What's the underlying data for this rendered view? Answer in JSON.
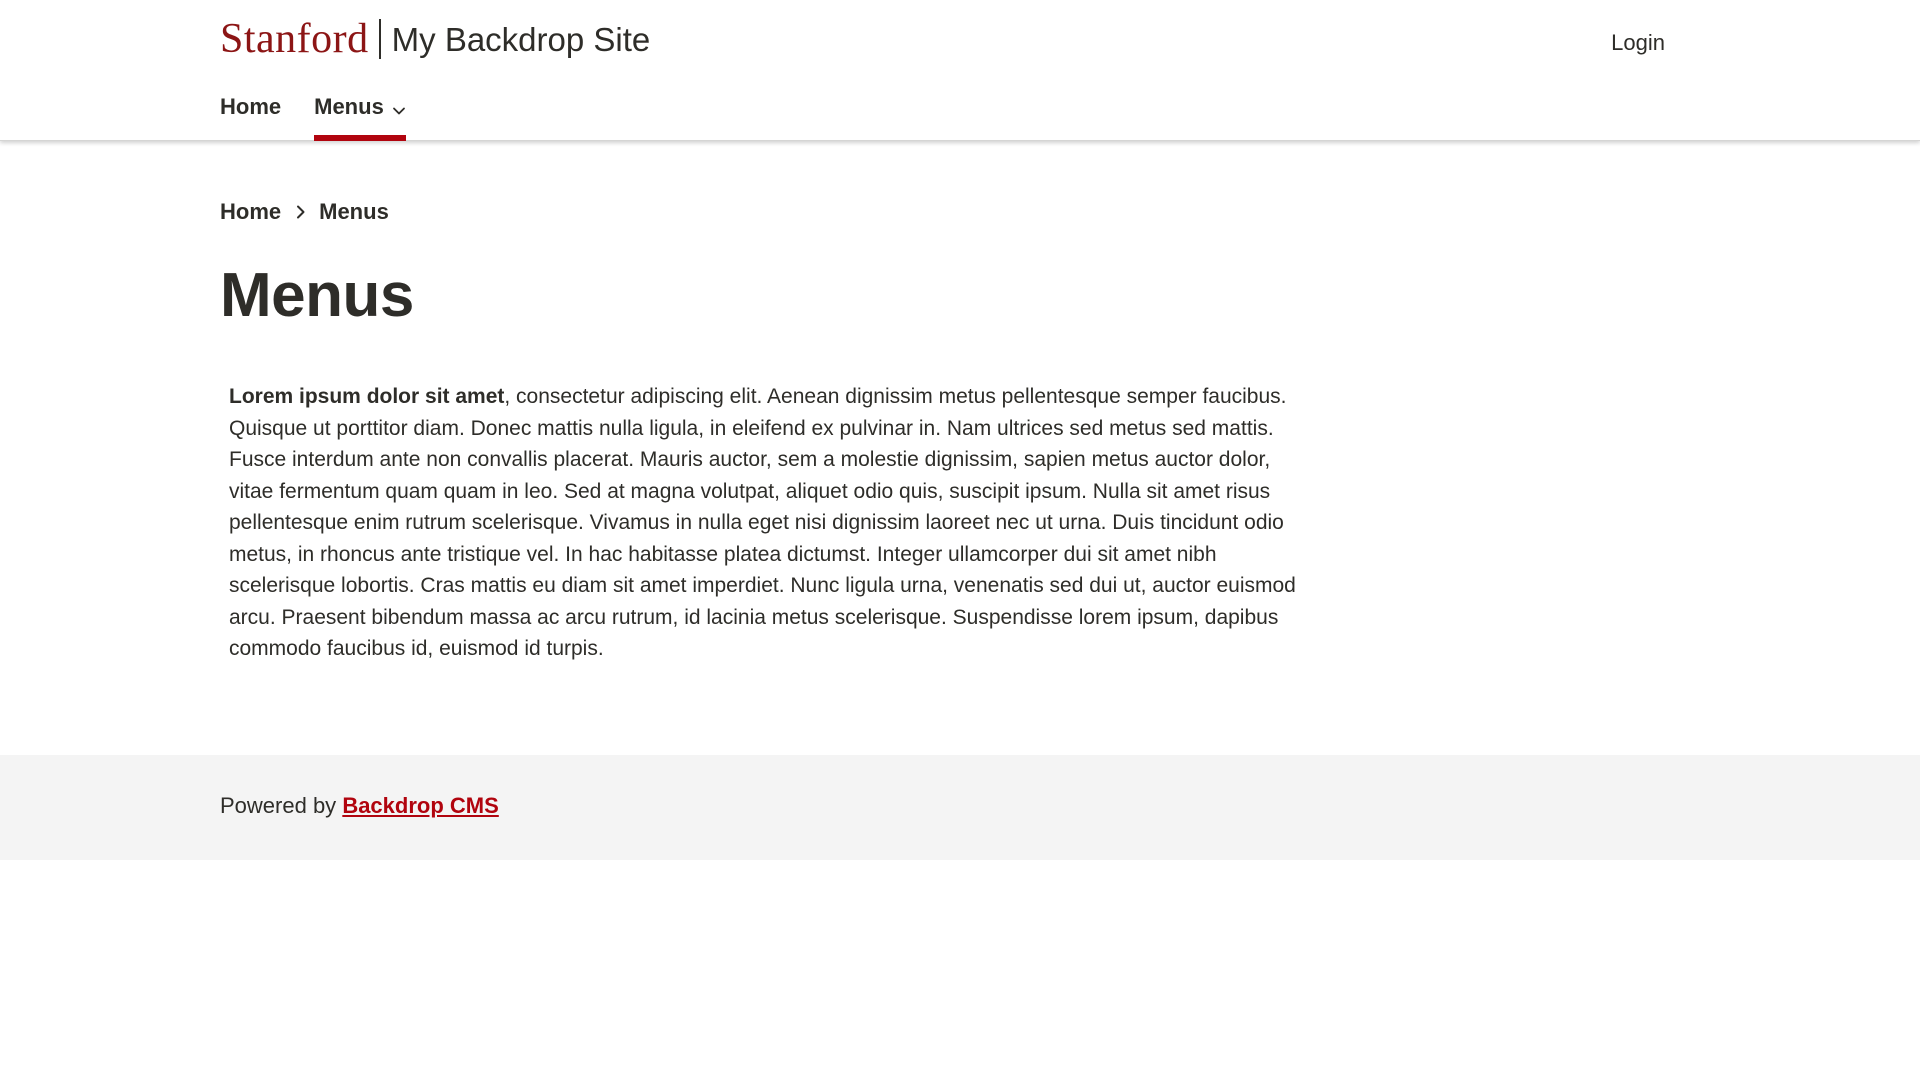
{
  "header": {
    "logo_text": "Stanford",
    "site_name": "My Backdrop Site",
    "login_label": "Login"
  },
  "nav": {
    "items": [
      {
        "label": "Home",
        "active": false
      },
      {
        "label": "Menus",
        "active": true,
        "has_dropdown": true
      }
    ]
  },
  "breadcrumb": {
    "items": [
      "Home",
      "Menus"
    ]
  },
  "page": {
    "title": "Menus",
    "body_bold": "Lorem ipsum dolor sit amet",
    "body_rest": ", consectetur adipiscing elit. Aenean dignissim metus pellentesque semper faucibus. Quisque ut porttitor diam. Donec mattis nulla ligula, in eleifend ex pulvinar in. Nam ultrices sed metus sed mattis. Fusce interdum ante non convallis placerat. Mauris auctor, sem a molestie dignissim, sapien metus auctor dolor, vitae fermentum quam quam in leo. Sed at magna volutpat, aliquet odio quis, suscipit ipsum. Nulla sit amet risus pellentesque enim rutrum scelerisque. Vivamus in nulla eget nisi dignissim laoreet nec ut urna. Duis tincidunt odio metus, in rhoncus ante tristique vel. In hac habitasse platea dictumst. Integer ullamcorper dui sit amet nibh scelerisque lobortis. Cras mattis eu diam sit amet imperdiet. Nunc ligula urna, venenatis sed dui ut, auctor euismod arcu. Praesent bibendum massa ac arcu rutrum, id lacinia metus scelerisque. Suspendisse lorem ipsum, dapibus commodo faucibus id, euismod id turpis."
  },
  "footer": {
    "powered_by": "Powered by",
    "cms_link": "Backdrop CMS"
  },
  "colors": {
    "brand_red": "#8c1515",
    "accent_red": "#b1040e",
    "text": "#2e2d29",
    "footer_bg": "#f4f4f4"
  },
  "icons": {
    "nav_dropdown": "chevron-down-icon",
    "breadcrumb_separator": "chevron-right-icon"
  }
}
